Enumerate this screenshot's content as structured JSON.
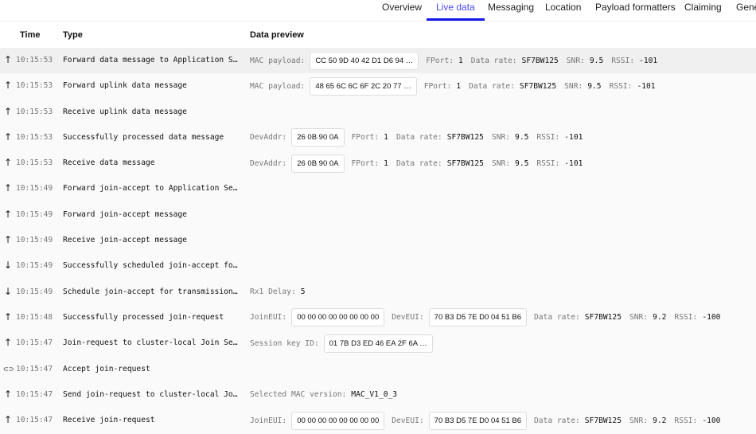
{
  "tabs": [
    {
      "label": "Overview"
    },
    {
      "label": "Live data",
      "active": true
    },
    {
      "label": "Messaging"
    },
    {
      "label": "Location"
    },
    {
      "label": "Payload formatters"
    },
    {
      "label": "Claiming"
    },
    {
      "label": "Gene"
    }
  ],
  "columns": {
    "time": "Time",
    "type": "Type",
    "preview": "Data preview"
  },
  "rows": [
    {
      "icon": "arrow-up-icon",
      "time": "10:15:53",
      "type": "Forward data message to Application S…",
      "selected": true,
      "preview": [
        {
          "k": "MAC payload:",
          "v": "CC 50 9D 40 42 D1 D6 94 …",
          "box": true
        },
        {
          "k": "FPort:",
          "v": "1"
        },
        {
          "k": "Data rate:",
          "v": "SF7BW125"
        },
        {
          "k": "SNR:",
          "v": "9.5"
        },
        {
          "k": "RSSI:",
          "v": "-101"
        }
      ]
    },
    {
      "icon": "arrow-up-icon",
      "time": "10:15:53",
      "type": "Forward uplink data message",
      "preview": [
        {
          "k": "MAC payload:",
          "v": "48 65 6C 6C 6F 2C 20 77 …",
          "box": true
        },
        {
          "k": "FPort:",
          "v": "1"
        },
        {
          "k": "Data rate:",
          "v": "SF7BW125"
        },
        {
          "k": "SNR:",
          "v": "9.5"
        },
        {
          "k": "RSSI:",
          "v": "-101"
        }
      ]
    },
    {
      "icon": "arrow-up-icon",
      "time": "10:15:53",
      "type": "Receive uplink data message",
      "preview": []
    },
    {
      "icon": "arrow-up-icon",
      "time": "10:15:53",
      "type": "Successfully processed data message",
      "preview": [
        {
          "k": "DevAddr:",
          "v": "26 0B 90 0A",
          "box": true
        },
        {
          "k": "FPort:",
          "v": "1"
        },
        {
          "k": "Data rate:",
          "v": "SF7BW125"
        },
        {
          "k": "SNR:",
          "v": "9.5"
        },
        {
          "k": "RSSI:",
          "v": "-101"
        }
      ]
    },
    {
      "icon": "arrow-up-icon",
      "time": "10:15:53",
      "type": "Receive data message",
      "preview": [
        {
          "k": "DevAddr:",
          "v": "26 0B 90 0A",
          "box": true
        },
        {
          "k": "FPort:",
          "v": "1"
        },
        {
          "k": "Data rate:",
          "v": "SF7BW125"
        },
        {
          "k": "SNR:",
          "v": "9.5"
        },
        {
          "k": "RSSI:",
          "v": "-101"
        }
      ]
    },
    {
      "icon": "arrow-up-icon",
      "time": "10:15:49",
      "type": "Forward join-accept to Application Se…",
      "preview": []
    },
    {
      "icon": "arrow-up-icon",
      "time": "10:15:49",
      "type": "Forward join-accept message",
      "preview": []
    },
    {
      "icon": "arrow-up-icon",
      "time": "10:15:49",
      "type": "Receive join-accept message",
      "preview": []
    },
    {
      "icon": "arrow-down-icon",
      "time": "10:15:49",
      "type": "Successfully scheduled join-accept fo…",
      "preview": []
    },
    {
      "icon": "arrow-down-icon",
      "time": "10:15:49",
      "type": "Schedule join-accept for transmission…",
      "preview": [
        {
          "k": "Rx1 Delay:",
          "v": "5"
        }
      ]
    },
    {
      "icon": "arrow-up-icon",
      "time": "10:15:48",
      "type": "Successfully processed join-request",
      "preview": [
        {
          "k": "JoinEUI:",
          "v": "00 00 00 00 00 00 00 00",
          "box": true
        },
        {
          "k": "DevEUI:",
          "v": "70 B3 D5 7E D0 04 51 B6",
          "box": true
        },
        {
          "k": "Data rate:",
          "v": "SF7BW125"
        },
        {
          "k": "SNR:",
          "v": "9.2"
        },
        {
          "k": "RSSI:",
          "v": "-100"
        }
      ]
    },
    {
      "icon": "arrow-up-icon",
      "time": "10:15:47",
      "type": "Join-request to cluster-local Join Se…",
      "preview": [
        {
          "k": "Session key ID:",
          "v": "01 7B D3 ED 46 EA 2F 6A …",
          "box": true
        }
      ]
    },
    {
      "icon": "link-icon",
      "time": "10:15:47",
      "type": "Accept join-request",
      "preview": []
    },
    {
      "icon": "arrow-up-icon",
      "time": "10:15:47",
      "type": "Send join-request to cluster-local Jo…",
      "preview": [
        {
          "k": "Selected MAC version:",
          "v": "MAC_V1_0_3"
        }
      ]
    },
    {
      "icon": "arrow-up-icon",
      "time": "10:15:47",
      "type": "Receive join-request",
      "preview": [
        {
          "k": "JoinEUI:",
          "v": "00 00 00 00 00 00 00 00",
          "box": true
        },
        {
          "k": "DevEUI:",
          "v": "70 B3 D5 7E D0 04 51 B6",
          "box": true
        },
        {
          "k": "Data rate:",
          "v": "SF7BW125"
        },
        {
          "k": "SNR:",
          "v": "9.2"
        },
        {
          "k": "RSSI:",
          "v": "-100"
        }
      ]
    }
  ]
}
